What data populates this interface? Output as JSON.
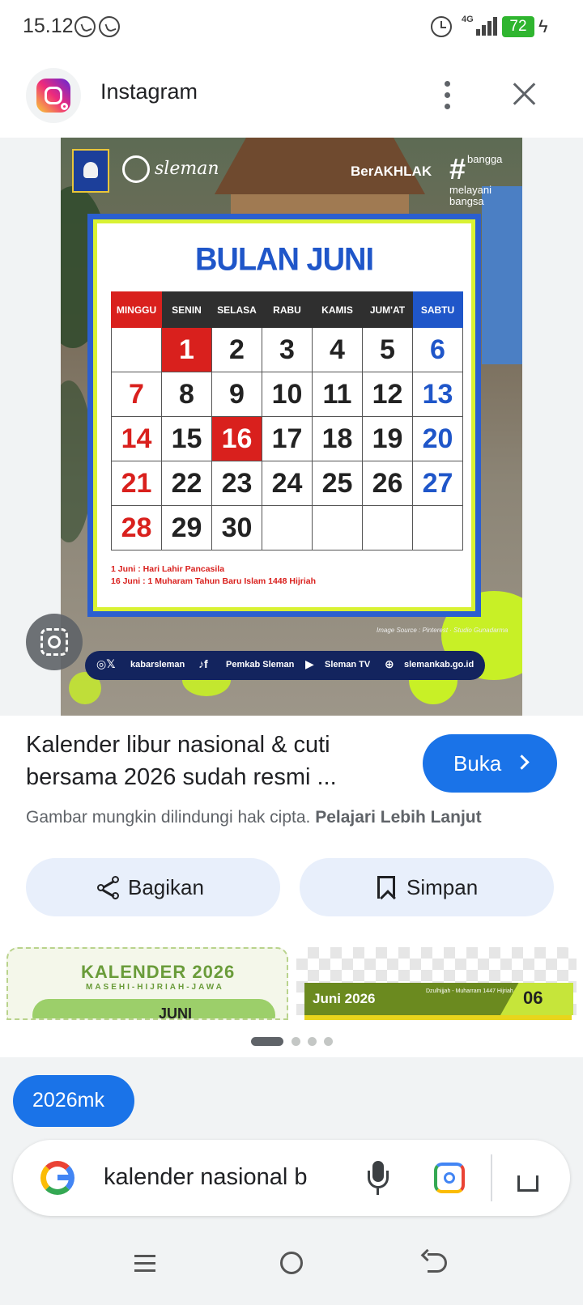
{
  "status_bar": {
    "time": "15.12",
    "network": "4G",
    "battery": "72"
  },
  "header": {
    "source_name": "Instagram"
  },
  "poster": {
    "org_name": "sleman",
    "berakhlak": "BerAKHLAK",
    "slogan": [
      "bangga",
      "melayani",
      "bangsa"
    ],
    "calendar": {
      "title": "BULAN JUNI",
      "weekdays": [
        "MINGGU",
        "SENIN",
        "SELASA",
        "RABU",
        "KAMIS",
        "JUM'AT",
        "SABTU"
      ],
      "weeks": [
        [
          "",
          "1",
          "2",
          "3",
          "4",
          "5",
          "6"
        ],
        [
          "7",
          "8",
          "9",
          "10",
          "11",
          "12",
          "13"
        ],
        [
          "14",
          "15",
          "16",
          "17",
          "18",
          "19",
          "20"
        ],
        [
          "21",
          "22",
          "23",
          "24",
          "25",
          "26",
          "27"
        ],
        [
          "28",
          "29",
          "30",
          "",
          "",
          "",
          ""
        ]
      ],
      "holidays": [
        "1",
        "16"
      ],
      "notes": [
        "1 Juni   : Hari Lahir Pancasila",
        "16 Juni : 1 Muharam Tahun Baru Islam 1448 Hijriah"
      ]
    },
    "photo_credit": "Image Source : Pinterest · Studio Gunadarma",
    "social": {
      "instagram_x": "kabarsleman",
      "tiktok_facebook": "Pemkab Sleman",
      "youtube": "Sleman TV",
      "website": "slemankab.go.id"
    }
  },
  "result": {
    "title": "Kalender libur nasional & cuti bersama 2026 sudah resmi ...",
    "open_label": "Buka",
    "copyright_text": "Gambar mungkin dilindungi hak cipta.",
    "learn_more": "Pelajari Lebih Lanjut",
    "share_label": "Bagikan",
    "save_label": "Simpan"
  },
  "related": [
    {
      "title": "KALENDER 2026",
      "subtitle": "MASEHI-HIJRIAH-JAWA",
      "month": "JUNI"
    },
    {
      "title": "Juni 2026",
      "subtitle": "Dzulhijjah - Muharram 1447 Hijriah",
      "number": "06"
    }
  ],
  "search": {
    "chip": "2026mk",
    "query": "kalender  nasional b"
  },
  "colors": {
    "accent": "#1a73e8",
    "holiday_red": "#d9201d",
    "saturday_blue": "#1f56c9",
    "pill_bg": "#e8effb"
  }
}
